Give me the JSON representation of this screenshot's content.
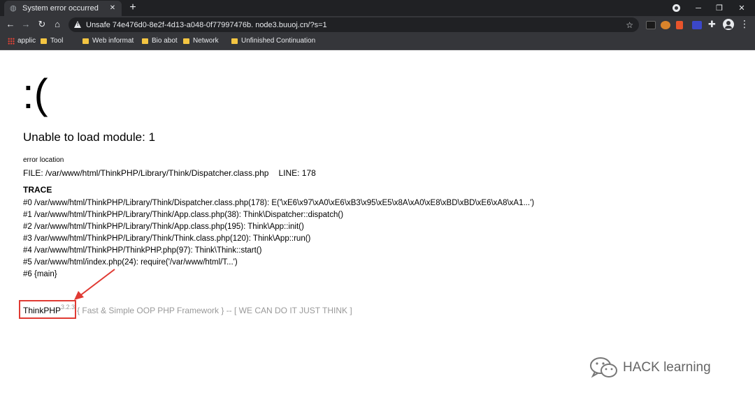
{
  "browser": {
    "tab_title": "System error occurred",
    "tab_close": "✕",
    "new_tab": "+",
    "address": "Unsafe 74e476d0-8e2f-4d13-a048-0f77997476b. node3.buuoj.cn/?s=1",
    "window_controls": {
      "minimize": "─",
      "restore": "❐",
      "close": "✕"
    },
    "bookmarks": [
      {
        "label": "applic"
      },
      {
        "label": "Tool"
      },
      {
        "label": "Web informat"
      },
      {
        "label": "Bio abot"
      },
      {
        "label": "Network"
      },
      {
        "label": "Unfinished Continuation"
      }
    ]
  },
  "page": {
    "face": ":(",
    "error_message": "Unable to load module: 1",
    "location_label": "error location",
    "file_text": "FILE: /var/www/html/ThinkPHP/Library/Think/Dispatcher.class.php",
    "line_text": "LINE: 178",
    "trace_heading": "TRACE",
    "trace": [
      "#0 /var/www/html/ThinkPHP/Library/Think/Dispatcher.class.php(178): E('\\xE6\\x97\\xA0\\xE6\\xB3\\x95\\xE5\\x8A\\xA0\\xE8\\xBD\\xBD\\xE6\\xA8\\xA1...')",
      "#1 /var/www/html/ThinkPHP/Library/Think/App.class.php(38): Think\\Dispatcher::dispatch()",
      "#2 /var/www/html/ThinkPHP/Library/Think/App.class.php(195): Think\\App::init()",
      "#3 /var/www/html/ThinkPHP/Library/Think/Think.class.php(120): Think\\App::run()",
      "#4 /var/www/html/ThinkPHP/ThinkPHP.php(97): Think\\Think::start()",
      "#5 /var/www/html/index.php(24): require('/var/www/html/T...')",
      "#6 {main}"
    ],
    "brand": "ThinkPHP",
    "version": "3.2.3",
    "slogan": "{ Fast & Simple OOP PHP Framework } -- [ WE CAN DO IT JUST THINK ]",
    "watermark": "HACK learning"
  },
  "colors": {
    "annotation": "#e03a33",
    "chrome_dark": "#202124",
    "chrome_mid": "#35363a"
  }
}
